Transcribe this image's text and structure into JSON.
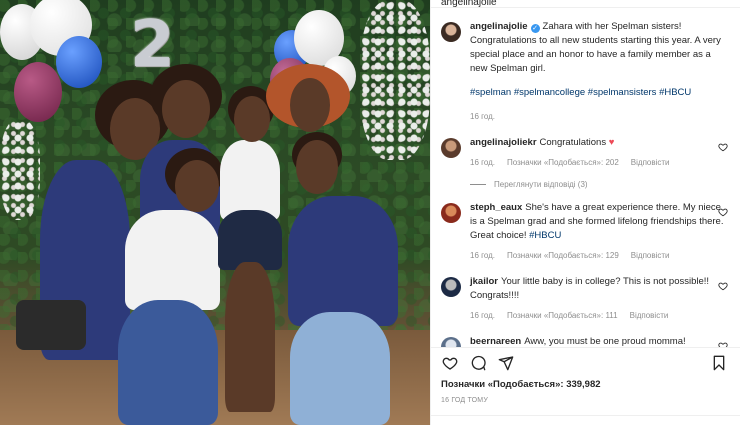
{
  "top": {
    "username": "angelinajolie"
  },
  "post": {
    "username": "angelinajolie",
    "caption": "Zahara with her Spelman sisters! Congratulations to all new students starting this year. A very special place and an honor to have a family member as a new Spelman girl.",
    "hashtags": [
      "#spelman",
      "#spelmancollege",
      "#spelmansisters",
      "#HBCU"
    ],
    "time": "16 год."
  },
  "comments": [
    {
      "username": "angelinajoliekr",
      "text": "Congratulations",
      "emoji": "♥",
      "time": "16 год.",
      "likes": "Позначки «Подобається»: 202",
      "reply": "Відповісти",
      "view_replies": "Переглянути відповіді (3)"
    },
    {
      "username": "steph_eaux",
      "text": "She's have a great experience there. My niece is a Spelman grad and she formed lifelong friendships there. Great choice!",
      "tag": "#HBCU",
      "time": "16 год.",
      "likes": "Позначки «Подобається»: 129",
      "reply": "Відповісти"
    },
    {
      "username": "jkailor",
      "text": "Your little baby is in college? This is not possible!! Congrats!!!!",
      "time": "16 год.",
      "likes": "Позначки «Подобається»: 111",
      "reply": "Відповісти"
    },
    {
      "username": "beernareen",
      "text": "Aww, you must be one proud momma! Congratulations",
      "emoji": "👏"
    }
  ],
  "actions": {
    "likes": "Позначки «Подобається»: 339,982",
    "posted": "16 ГОД ТОМУ"
  },
  "photo": {
    "number": "2"
  },
  "icons": [
    "heart-icon",
    "comment-icon",
    "share-icon",
    "bookmark-icon"
  ],
  "colors": {
    "hashtag": "#00376b",
    "verified": "#3897f0",
    "heart": "#ed4956",
    "muted": "#8e8e8e"
  }
}
